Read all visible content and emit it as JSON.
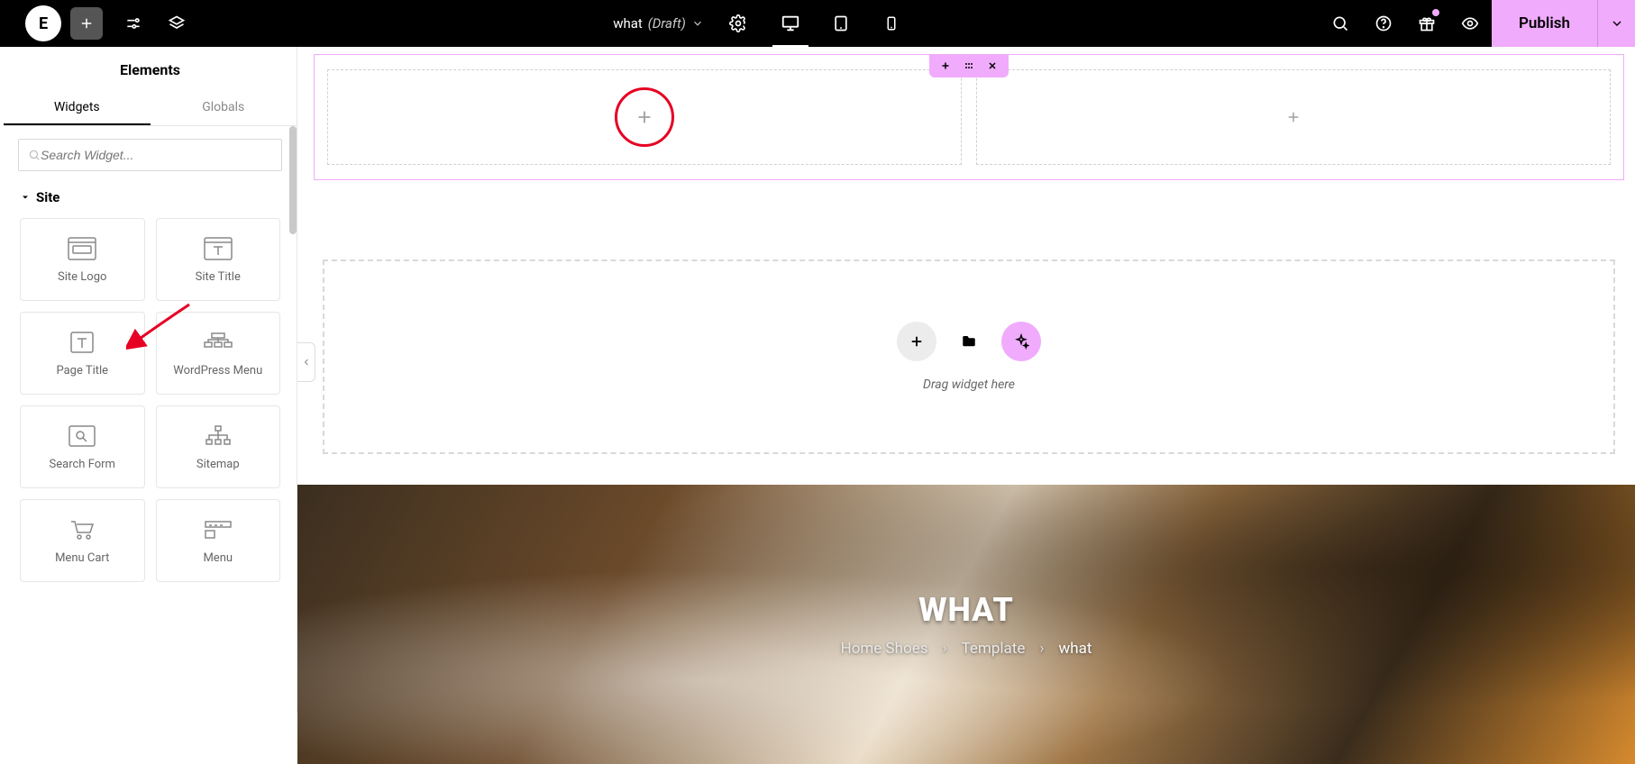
{
  "topbar": {
    "doc_name": "what",
    "doc_status": "(Draft)",
    "publish_label": "Publish"
  },
  "panel": {
    "title": "Elements",
    "tabs": {
      "widgets": "Widgets",
      "globals": "Globals"
    },
    "search_placeholder": "Search Widget...",
    "category": "Site",
    "widgets": [
      {
        "label": "Site Logo"
      },
      {
        "label": "Site Title"
      },
      {
        "label": "Page Title"
      },
      {
        "label": "WordPress Menu"
      },
      {
        "label": "Search Form"
      },
      {
        "label": "Sitemap"
      },
      {
        "label": "Menu Cart"
      },
      {
        "label": "Menu"
      }
    ]
  },
  "canvas": {
    "drop_text": "Drag widget here"
  },
  "hero": {
    "title": "WHAT",
    "crumbs": [
      "Home Shoes",
      "Template",
      "what"
    ],
    "sep": "›"
  }
}
